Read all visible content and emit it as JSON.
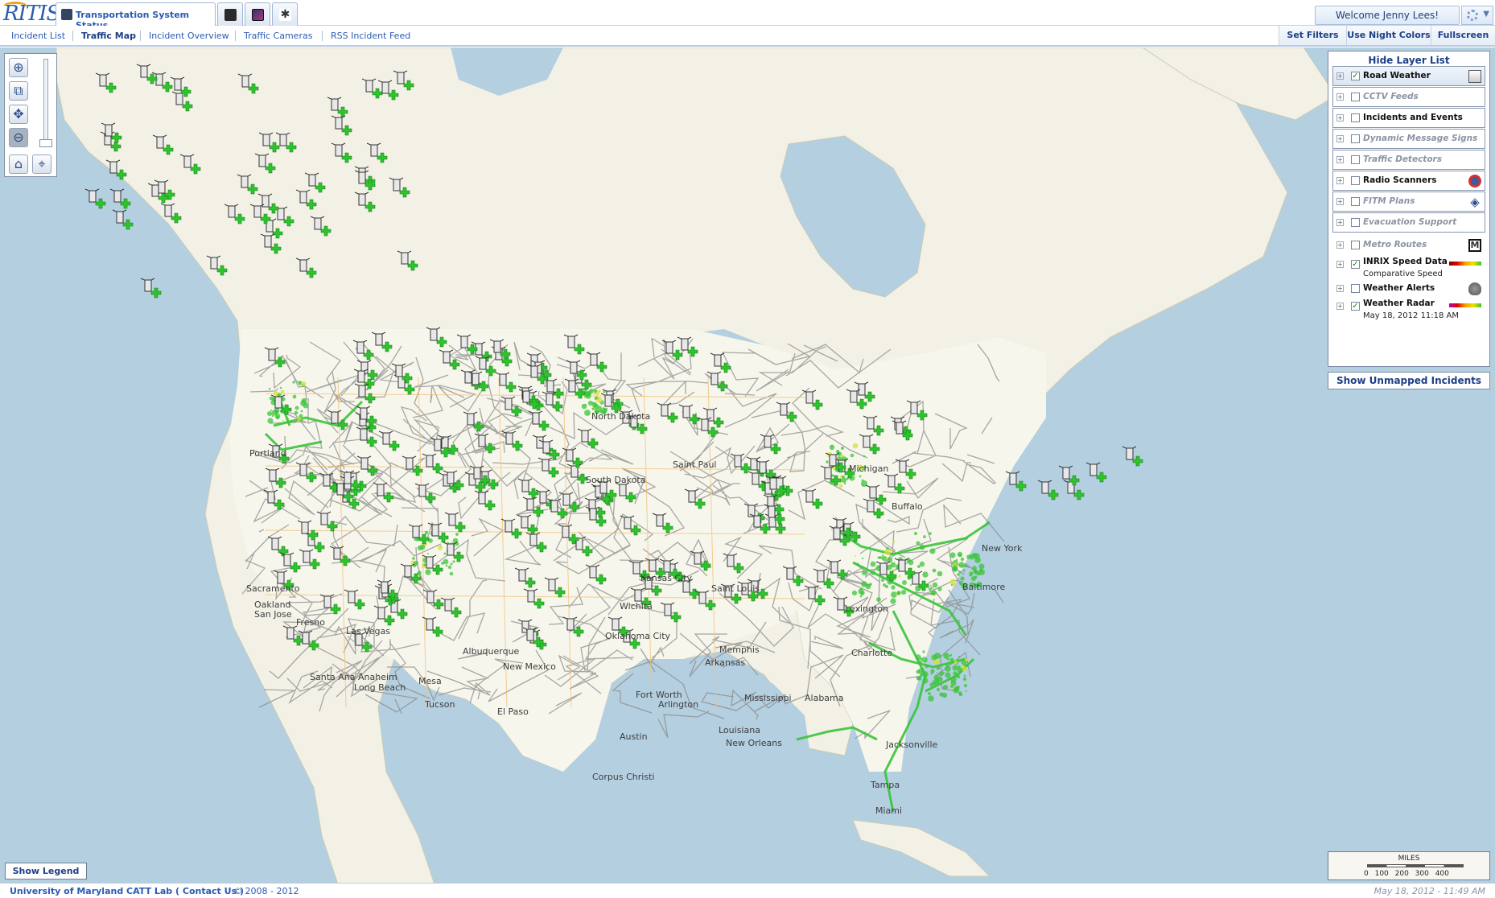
{
  "app": {
    "logo_text": "RITIS",
    "main_tab_label": "Transportation System Status",
    "welcome_text": "Welcome Jenny Lees!"
  },
  "nav": {
    "links": [
      "Incident List",
      "Traffic Map",
      "Incident Overview",
      "Traffic Cameras",
      "RSS Incident Feed"
    ],
    "active": "Traffic Map",
    "buttons": [
      "Set Filters",
      "Use Night Colors",
      "Fullscreen"
    ]
  },
  "map": {
    "cities": [
      "Portland",
      "Sacramento",
      "Oakland",
      "San Jose",
      "Fresno",
      "Las Vegas",
      "Santa Ana",
      "Anaheim",
      "Long Beach",
      "Mesa",
      "Tucson",
      "El Paso",
      "Albuquerque",
      "New Mexico",
      "Oklahoma City",
      "Wichita",
      "Kansas City",
      "Saint Louis",
      "Memphis",
      "Arkansas",
      "Fort Worth",
      "Arlington",
      "Austin",
      "Louisiana",
      "New Orleans",
      "Corpus Christi",
      "Mississippi",
      "Alabama",
      "Jacksonville",
      "Tampa",
      "Miami",
      "Charlotte",
      "Lexington",
      "Buffalo",
      "Michigan",
      "Saint Paul",
      "North Dakota",
      "South Dakota",
      "Baltimore",
      "New York"
    ],
    "colors": {
      "water": "#b4cfe0",
      "land": "#f3f1e6",
      "us_land": "#f7f6ec",
      "roads": "#8b8b8b",
      "inrix_speed": "#39c43a",
      "radar": "#d8e030"
    },
    "marker_icon": "road-weather-station-icon"
  },
  "tools": {
    "zoom_in": "zoom-in",
    "zoom_box": "zoom-box",
    "pan": "pan",
    "zoom_out": "zoom-out",
    "home": "home",
    "locate": "locate"
  },
  "layers": {
    "title": "Hide Layer List",
    "items": [
      {
        "label": "Road Weather",
        "checked": true,
        "enabled": true,
        "icon": "road-weather-icon"
      },
      {
        "label": "CCTV Feeds",
        "checked": false,
        "enabled": false,
        "icon": ""
      },
      {
        "label": "Incidents and Events",
        "checked": false,
        "enabled": true,
        "icon": ""
      },
      {
        "label": "Dynamic Message Signs",
        "checked": false,
        "enabled": false,
        "icon": ""
      },
      {
        "label": "Traffic Detectors",
        "checked": false,
        "enabled": false,
        "icon": ""
      },
      {
        "label": "Radio Scanners",
        "checked": false,
        "enabled": true,
        "icon": "radio-scanner-icon"
      },
      {
        "label": "FITM Plans",
        "checked": false,
        "enabled": false,
        "icon": "fitm-plan-icon"
      },
      {
        "label": "Evacuation Support",
        "checked": false,
        "enabled": false,
        "icon": ""
      },
      {
        "label": "Metro Routes",
        "checked": false,
        "enabled": false,
        "icon": "metro-icon"
      },
      {
        "label": "INRIX Speed Data",
        "sub": "Comparative Speed",
        "checked": true,
        "enabled": true,
        "icon": "speed-gradient-icon"
      },
      {
        "label": "Weather Alerts",
        "checked": false,
        "enabled": true,
        "icon": "weather-alert-icon"
      },
      {
        "label": "Weather Radar",
        "sub": "May 18, 2012 11:18 AM",
        "checked": true,
        "enabled": true,
        "icon": "radar-gradient-icon"
      }
    ],
    "unmapped_button": "Show Unmapped Incidents"
  },
  "legend": {
    "button": "Show Legend",
    "scale_title": "MILES",
    "scale_ticks": "0 100 200 300 400"
  },
  "footer": {
    "org": "University of Maryland CATT Lab",
    "contact_open": "(",
    "contact": "Contact Us",
    "contact_close": ")",
    "copyright": "© 2008 - 2012",
    "timestamp": "May 18, 2012 - 11:49 AM"
  }
}
